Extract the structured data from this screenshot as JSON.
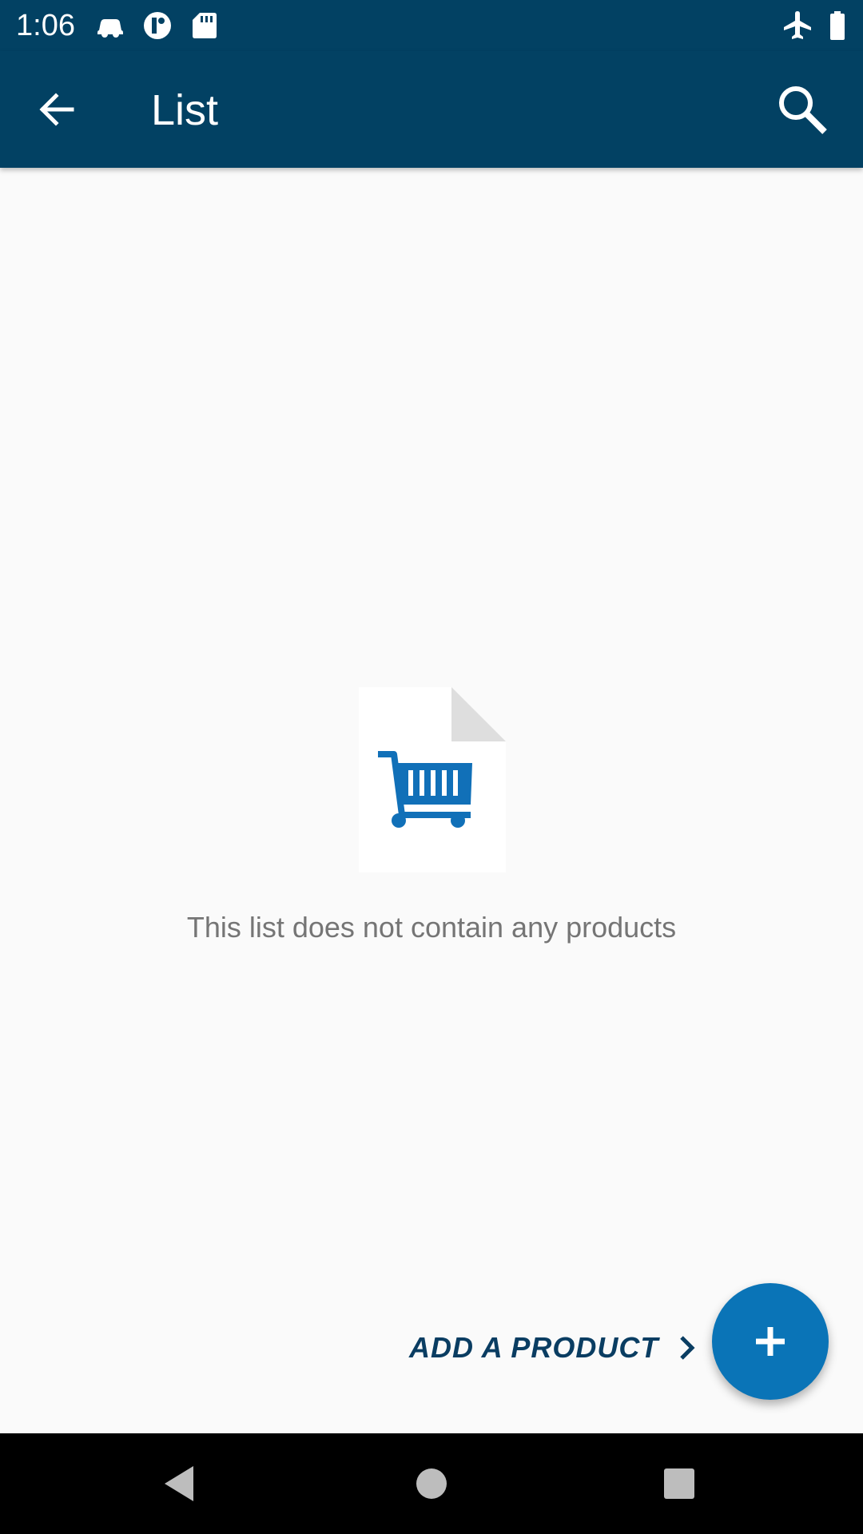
{
  "status_bar": {
    "time": "1:06",
    "icons_left": [
      "car-icon",
      "data-saver-icon",
      "sd-card-icon"
    ],
    "icons_right": [
      "airplane-mode-icon",
      "battery-icon"
    ]
  },
  "app_bar": {
    "title": "List",
    "back_icon": "arrow-back-icon",
    "search_icon": "search-icon",
    "background": "#024163"
  },
  "empty_state": {
    "illustration": "cart-document-icon",
    "message": "This list does not contain any products"
  },
  "actions": {
    "add_product_label": "ADD A PRODUCT",
    "add_product_icon": "chevron-right-icon",
    "fab_icon": "plus-icon",
    "fab_color": "#0a74b7"
  },
  "nav_bar": {
    "icons": [
      "nav-back-icon",
      "nav-home-icon",
      "nav-recents-icon"
    ]
  }
}
